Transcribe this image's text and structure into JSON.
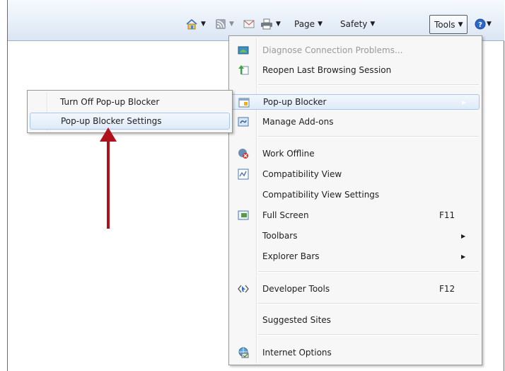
{
  "command_bar": {
    "page_label": "Page",
    "safety_label": "Safety",
    "tools_label": "Tools",
    "dropdown_glyph": "▼"
  },
  "tools_menu": {
    "items": [
      {
        "label": "Diagnose Connection Problems...",
        "shortcut": "",
        "disabled": true,
        "icon": "diagnose-icon"
      },
      {
        "label": "Reopen Last Browsing Session",
        "shortcut": "",
        "icon": "reopen-session-icon"
      },
      {
        "label": "Pop-up Blocker",
        "shortcut": "",
        "icon": "popup-blocker-icon",
        "submenu": true,
        "highlighted": true
      },
      {
        "label": "Manage Add-ons",
        "shortcut": "",
        "icon": "addons-icon"
      },
      {
        "label": "Work Offline",
        "shortcut": "",
        "icon": "work-offline-icon"
      },
      {
        "label": "Compatibility View",
        "shortcut": "",
        "icon": "compatibility-view-icon"
      },
      {
        "label": "Compatibility View Settings",
        "shortcut": ""
      },
      {
        "label": "Full Screen",
        "shortcut": "F11",
        "icon": "full-screen-icon"
      },
      {
        "label": "Toolbars",
        "shortcut": "",
        "submenu": true
      },
      {
        "label": "Explorer Bars",
        "shortcut": "",
        "submenu": true
      },
      {
        "label": "Developer Tools",
        "shortcut": "F12",
        "icon": "developer-tools-icon"
      },
      {
        "label": "Suggested Sites",
        "shortcut": ""
      },
      {
        "label": "Internet Options",
        "shortcut": "",
        "icon": "internet-options-icon"
      }
    ],
    "submenu_glyph": "▶"
  },
  "popup_submenu": {
    "items": [
      {
        "label": "Turn Off Pop-up Blocker"
      },
      {
        "label": "Pop-up Blocker Settings",
        "highlighted": true
      }
    ]
  },
  "colors": {
    "annotation_arrow": "#b0121b",
    "highlight_border": "#a8c6ee",
    "menu_background": "#f7f7f7"
  }
}
